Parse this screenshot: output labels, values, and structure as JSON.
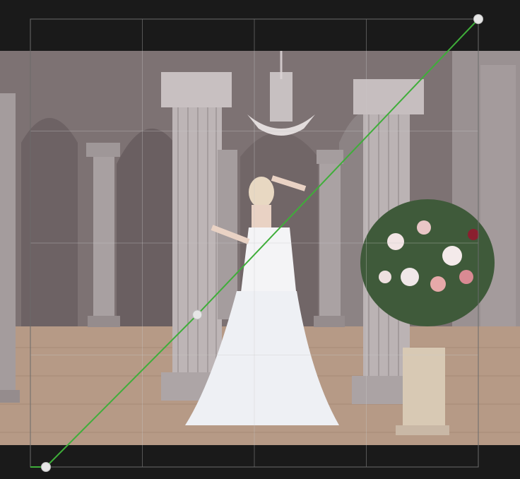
{
  "editor": {
    "tool": "tone-curve",
    "channel_color": "#3fae3a",
    "grid_divisions": 4,
    "curve_points": [
      {
        "input": 0.0,
        "output": 0.0
      },
      {
        "input": 0.35,
        "output": 0.34
      },
      {
        "input": 1.0,
        "output": 1.0
      }
    ],
    "histogram_present": false
  },
  "image": {
    "subject": "photo-bride-in-palace-hall",
    "dominant_colors": [
      "#6e6466",
      "#8a7f80",
      "#a98e7c",
      "#f4f4f6",
      "#c9b8a6"
    ]
  }
}
